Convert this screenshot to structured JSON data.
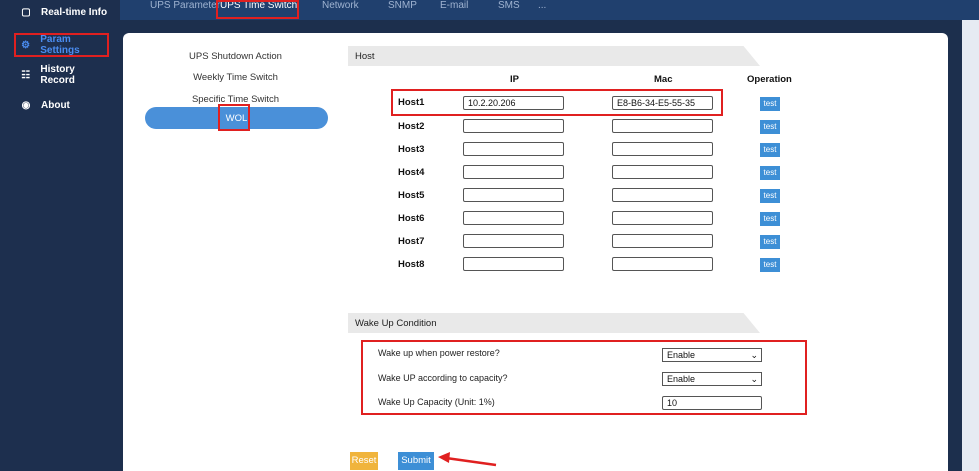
{
  "sidebar": {
    "items": [
      {
        "label": "Real-time Info",
        "icon": "monitor-icon"
      },
      {
        "label": "Param Settings",
        "icon": "gear-icon"
      },
      {
        "label": "History Record",
        "icon": "history-icon"
      },
      {
        "label": "About",
        "icon": "about-icon"
      }
    ]
  },
  "topbar": {
    "tabs": [
      "UPS Parameter",
      "UPS Time Switch",
      "Network",
      "SNMP",
      "E-mail",
      "SMS",
      "..."
    ]
  },
  "submenu": {
    "items": [
      "UPS Shutdown Action",
      "Weekly Time Switch",
      "Specific Time Switch",
      "WOL"
    ]
  },
  "host_section": {
    "title": "Host",
    "col_ip": "IP",
    "col_mac": "Mac",
    "col_operation": "Operation",
    "test_label": "test",
    "rows": [
      {
        "label": "Host1",
        "ip": "10.2.20.206",
        "mac": "E8-B6-34-E5-55-35"
      },
      {
        "label": "Host2",
        "ip": "",
        "mac": ""
      },
      {
        "label": "Host3",
        "ip": "",
        "mac": ""
      },
      {
        "label": "Host4",
        "ip": "",
        "mac": ""
      },
      {
        "label": "Host5",
        "ip": "",
        "mac": ""
      },
      {
        "label": "Host6",
        "ip": "",
        "mac": ""
      },
      {
        "label": "Host7",
        "ip": "",
        "mac": ""
      },
      {
        "label": "Host8",
        "ip": "",
        "mac": ""
      }
    ]
  },
  "wake_section": {
    "title": "Wake Up Condition",
    "power_restore_label": "Wake up when power restore?",
    "power_restore_value": "Enable",
    "capacity_label": "Wake UP according to capacity?",
    "capacity_value": "Enable",
    "capacity_unit_label": "Wake Up Capacity (Unit: 1%)",
    "capacity_unit_value": "10"
  },
  "actions": {
    "reset_label": "Reset",
    "submit_label": "Submit"
  },
  "colors": {
    "accent": "#3d8fd6",
    "highlight": "#e02020",
    "reset": "#f0b43c"
  }
}
